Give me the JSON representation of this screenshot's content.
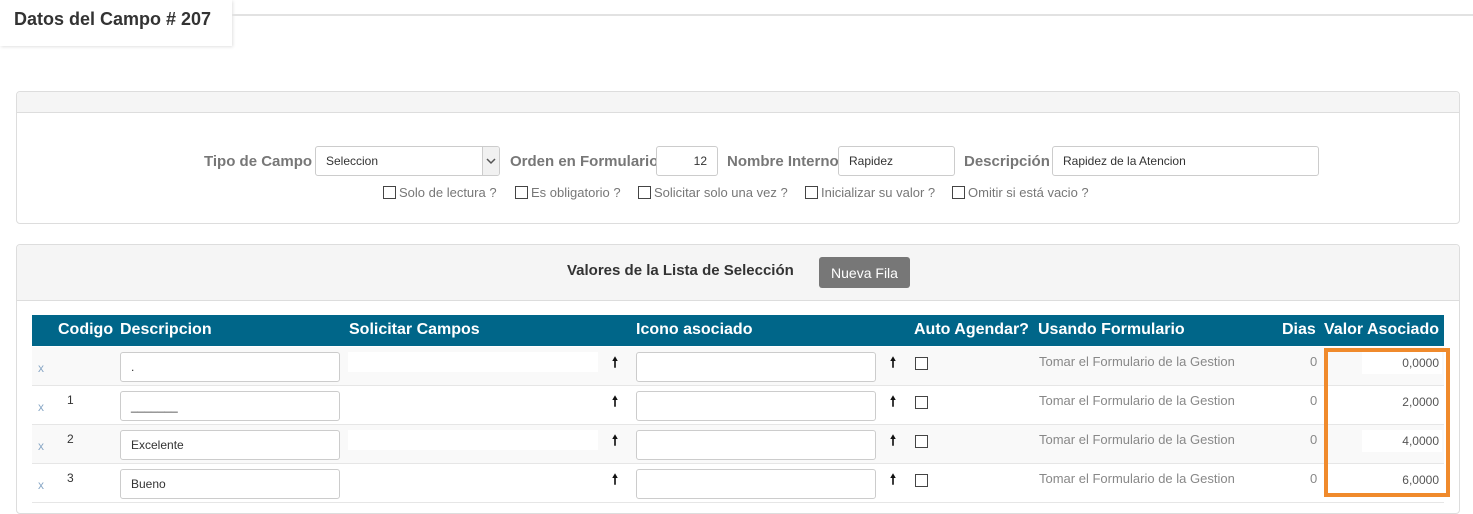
{
  "page": {
    "title": "Datos del Campo # 207"
  },
  "field": {
    "tipo_label": "Tipo de Campo",
    "tipo_value": "Seleccion",
    "orden_label": "Orden en Formulario",
    "orden_value": "12",
    "nombre_label": "Nombre Interno",
    "nombre_value": "Rapidez",
    "descripcion_label": "Descripción",
    "descripcion_value": "Rapidez de la Atencion",
    "options": [
      {
        "label": "Solo de lectura ?",
        "checked": false
      },
      {
        "label": "Es obligatorio ?",
        "checked": false
      },
      {
        "label": "Solicitar solo una vez ?",
        "checked": false
      },
      {
        "label": "Inicializar su valor ?",
        "checked": false
      },
      {
        "label": "Omitir si está vacio ?",
        "checked": false
      }
    ]
  },
  "list": {
    "title": "Valores de la Lista de Selección",
    "new_row_label": "Nueva Fila",
    "columns": {
      "codigo": "Codigo",
      "descripcion": "Descripcion",
      "solicitar": "Solicitar Campos",
      "icono": "Icono asociado",
      "auto": "Auto Agendar?",
      "usando": "Usando Formulario",
      "dias": "Dias",
      "valor": "Valor Asociado"
    },
    "rows": [
      {
        "delete": "x",
        "codigo": "",
        "descripcion": ".",
        "up": "🠕",
        "formulario": "Tomar el Formulario de la Gestion",
        "dias": "0",
        "valor": "0,0000"
      },
      {
        "delete": "x",
        "codigo": "1",
        "descripcion": "_______",
        "up": "🠕",
        "formulario": "Tomar el Formulario de la Gestion",
        "dias": "0",
        "valor": "2,0000"
      },
      {
        "delete": "x",
        "codigo": "2",
        "descripcion": "Excelente",
        "up": "🠕",
        "formulario": "Tomar el Formulario de la Gestion",
        "dias": "0",
        "valor": "4,0000"
      },
      {
        "delete": "x",
        "codigo": "3",
        "descripcion": "Bueno",
        "up": "🠕",
        "formulario": "Tomar el Formulario de la Gestion",
        "dias": "0",
        "valor": "6,0000"
      }
    ]
  },
  "colors": {
    "header_bg": "#006689",
    "highlight": "#f08a2c",
    "button_bg": "#777777"
  }
}
